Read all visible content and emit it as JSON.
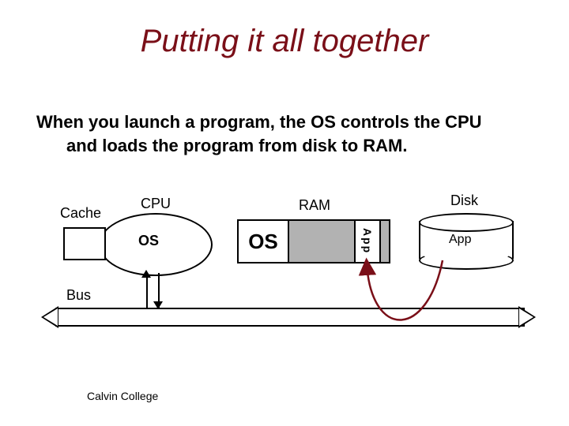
{
  "title": "Putting it all together",
  "description_line1": "When you launch a program, the OS controls the CPU",
  "description_line2": "and loads the program from disk to RAM.",
  "labels": {
    "cache": "Cache",
    "cpu": "CPU",
    "ram": "RAM",
    "disk": "Disk",
    "bus": "Bus"
  },
  "cpu_content": "OS",
  "ram_os_cell": "OS",
  "ram_app_cell": "App",
  "disk_app": "App",
  "footer": "Calvin College",
  "colors": {
    "title": "#7a0f18",
    "arrow": "#7a0f18",
    "ram_fill": "#b2b2b2"
  },
  "diagram": {
    "components": [
      "Cache",
      "CPU",
      "RAM",
      "Disk",
      "Bus"
    ],
    "cpu_contents": [
      "OS"
    ],
    "ram_contents": [
      "OS",
      "App"
    ],
    "disk_contents": [
      "App"
    ],
    "data_flow": {
      "from": "Disk",
      "to": "RAM",
      "item": "App"
    }
  }
}
